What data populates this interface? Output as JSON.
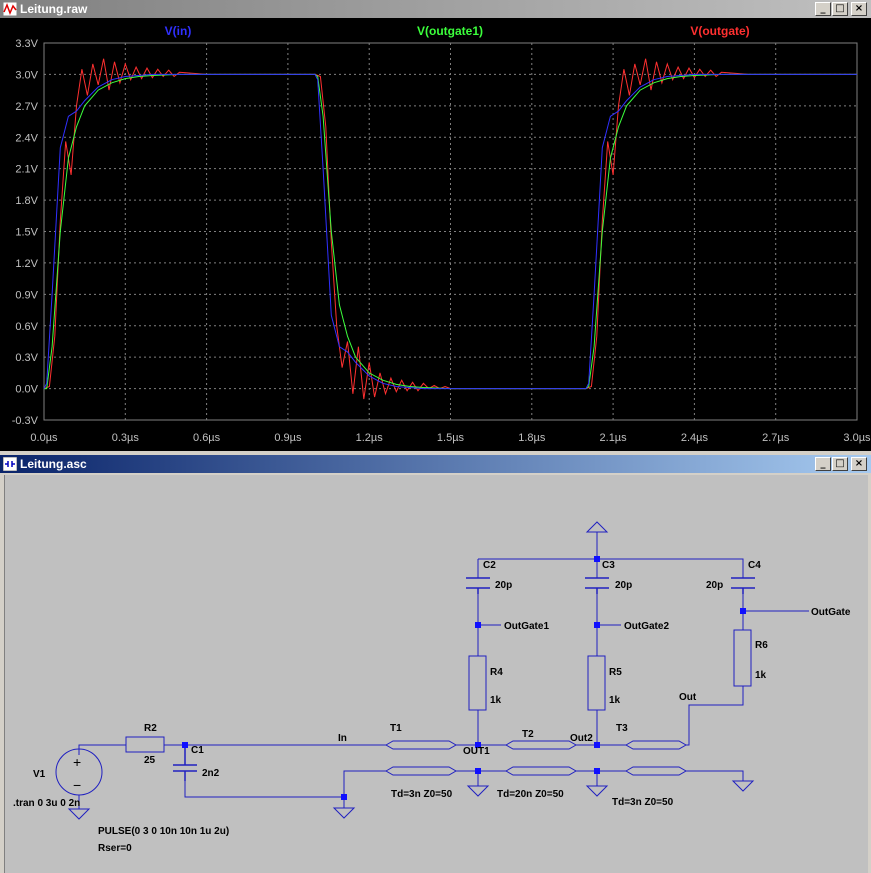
{
  "waveform_window": {
    "title": "Leitung.raw",
    "icon": "waveform-icon",
    "buttons": [
      "minimize-icon",
      "maximize-icon",
      "close-icon"
    ]
  },
  "schematic_window": {
    "title": "Leitung.asc",
    "icon": "schematic-icon",
    "buttons": [
      "minimize-icon",
      "maximize-icon",
      "close-icon"
    ]
  },
  "window_controls": {
    "minimize": "_",
    "maximize": "□",
    "close": "×"
  },
  "colors": {
    "plot_bg": "#000000",
    "grid": "#808080",
    "axis_text": "#c0c0c0",
    "vin": "#3030ff",
    "outgate1": "#3cff3c",
    "outgate": "#ff3030",
    "wire": "#2020c0",
    "junction": "#1010ff",
    "schematic_bg": "#c0c0c0"
  },
  "chart_data": {
    "type": "line",
    "title": "",
    "xlabel": "",
    "ylabel": "",
    "x_unit": "µs",
    "y_unit": "V",
    "xlim": [
      0.0,
      3.0
    ],
    "ylim": [
      -0.3,
      3.3
    ],
    "x_ticks": [
      "0.0µs",
      "0.3µs",
      "0.6µs",
      "0.9µs",
      "1.2µs",
      "1.5µs",
      "1.8µs",
      "2.1µs",
      "2.4µs",
      "2.7µs",
      "3.0µs"
    ],
    "y_ticks": [
      "3.3V",
      "3.0V",
      "2.7V",
      "2.4V",
      "2.1V",
      "1.8V",
      "1.5V",
      "1.2V",
      "0.9V",
      "0.6V",
      "0.3V",
      "0.0V",
      "-0.3V"
    ],
    "grid": true,
    "legend": "top",
    "series": [
      {
        "name": "V(in)",
        "color": "#3030ff",
        "x": [
          0.0,
          0.01,
          0.03,
          0.06,
          0.09,
          0.12,
          0.15,
          0.2,
          0.25,
          0.3,
          0.4,
          0.6,
          0.9,
          1.0,
          1.01,
          1.03,
          1.06,
          1.09,
          1.12,
          1.15,
          1.2,
          1.25,
          1.3,
          1.4,
          1.6,
          1.9,
          2.0,
          2.01,
          2.03,
          2.06,
          2.09,
          2.12,
          2.15,
          2.2,
          2.25,
          2.3,
          2.4,
          2.6,
          3.0
        ],
        "values": [
          0.0,
          0.05,
          0.9,
          2.3,
          2.6,
          2.65,
          2.75,
          2.88,
          2.95,
          2.98,
          3.0,
          3.0,
          3.0,
          3.0,
          2.95,
          2.1,
          0.7,
          0.4,
          0.35,
          0.25,
          0.12,
          0.05,
          0.02,
          0.0,
          0.0,
          0.0,
          0.0,
          0.05,
          0.9,
          2.3,
          2.6,
          2.65,
          2.75,
          2.88,
          2.95,
          2.98,
          3.0,
          3.0,
          3.0
        ]
      },
      {
        "name": "V(outgate1)",
        "color": "#3cff3c",
        "x": [
          0.0,
          0.01,
          0.03,
          0.06,
          0.09,
          0.12,
          0.15,
          0.2,
          0.25,
          0.3,
          0.35,
          0.4,
          0.5,
          0.7,
          1.0,
          1.01,
          1.03,
          1.06,
          1.09,
          1.12,
          1.15,
          1.2,
          1.25,
          1.3,
          1.35,
          1.4,
          1.5,
          1.7,
          2.0,
          2.01,
          2.03,
          2.06,
          2.09,
          2.12,
          2.15,
          2.2,
          2.25,
          2.3,
          2.35,
          2.4,
          2.5,
          2.7,
          3.0
        ],
        "values": [
          0.0,
          0.0,
          0.4,
          1.5,
          2.2,
          2.5,
          2.7,
          2.85,
          2.92,
          2.96,
          2.98,
          2.99,
          3.0,
          3.0,
          3.0,
          2.98,
          2.6,
          1.5,
          0.8,
          0.5,
          0.3,
          0.15,
          0.08,
          0.04,
          0.02,
          0.01,
          0.0,
          0.0,
          0.0,
          0.02,
          0.4,
          1.5,
          2.2,
          2.5,
          2.7,
          2.85,
          2.92,
          2.96,
          2.98,
          2.99,
          3.0,
          3.0,
          3.0
        ]
      },
      {
        "name": "V(outgate)",
        "color": "#ff3030",
        "x": [
          0.0,
          0.02,
          0.04,
          0.06,
          0.08,
          0.1,
          0.12,
          0.14,
          0.16,
          0.18,
          0.2,
          0.22,
          0.24,
          0.26,
          0.28,
          0.3,
          0.32,
          0.34,
          0.36,
          0.38,
          0.4,
          0.42,
          0.44,
          0.46,
          0.48,
          0.5,
          0.6,
          1.0,
          1.02,
          1.04,
          1.06,
          1.08,
          1.1,
          1.12,
          1.14,
          1.16,
          1.18,
          1.2,
          1.22,
          1.24,
          1.26,
          1.28,
          1.3,
          1.32,
          1.34,
          1.36,
          1.38,
          1.4,
          1.42,
          1.44,
          1.46,
          1.48,
          1.5,
          1.6,
          2.0,
          2.02,
          2.04,
          2.06,
          2.08,
          2.1,
          2.12,
          2.14,
          2.16,
          2.18,
          2.2,
          2.22,
          2.24,
          2.26,
          2.28,
          2.3,
          2.32,
          2.34,
          2.36,
          2.38,
          2.4,
          2.42,
          2.44,
          2.46,
          2.48,
          2.5,
          2.6,
          3.0
        ],
        "values": [
          0.0,
          0.02,
          0.5,
          1.6,
          2.36,
          2.04,
          2.7,
          3.05,
          2.8,
          3.1,
          2.9,
          3.15,
          2.85,
          3.12,
          2.92,
          3.1,
          2.95,
          3.07,
          2.96,
          3.06,
          2.97,
          3.05,
          2.98,
          3.04,
          2.98,
          3.02,
          3.0,
          3.0,
          2.98,
          2.5,
          1.4,
          0.6,
          0.2,
          0.45,
          -0.05,
          0.4,
          -0.1,
          0.25,
          -0.08,
          0.15,
          -0.05,
          0.1,
          -0.03,
          0.08,
          -0.02,
          0.06,
          -0.02,
          0.05,
          0.0,
          0.03,
          0.0,
          0.02,
          0.0,
          0.0,
          0.0,
          0.02,
          0.5,
          1.6,
          2.36,
          2.04,
          2.7,
          3.05,
          2.8,
          3.1,
          2.9,
          3.15,
          2.85,
          3.12,
          2.92,
          3.1,
          2.95,
          3.07,
          2.96,
          3.06,
          2.97,
          3.05,
          2.98,
          3.04,
          2.98,
          3.02,
          3.0,
          3.0
        ]
      }
    ]
  },
  "schematic": {
    "source": {
      "ref": "V1",
      "spice": ".tran 0 3u 0 2n",
      "pulse": "PULSE(0 3 0 10n 10n 1u 2u)",
      "rser": "Rser=0"
    },
    "resistors": [
      {
        "ref": "R2",
        "value": "25"
      },
      {
        "ref": "R4",
        "value": "1k"
      },
      {
        "ref": "R5",
        "value": "1k"
      },
      {
        "ref": "R6",
        "value": "1k"
      }
    ],
    "capacitors": [
      {
        "ref": "C1",
        "value": "2n2"
      },
      {
        "ref": "C2",
        "value": "20p"
      },
      {
        "ref": "C3",
        "value": "20p"
      },
      {
        "ref": "C4",
        "value": "20p"
      }
    ],
    "tlines": [
      {
        "ref": "T1",
        "params": "Td=3n Z0=50"
      },
      {
        "ref": "T2",
        "params": "Td=20n Z0=50"
      },
      {
        "ref": "T3",
        "params": "Td=3n Z0=50"
      }
    ],
    "nets": {
      "in": "In",
      "out1": "OUT1",
      "out2": "Out2",
      "out": "Out",
      "outgate1": "OutGate1",
      "outgate2": "OutGate2",
      "outgate": "OutGate"
    },
    "source_symbols": {
      "plus": "+",
      "minus": "−"
    }
  }
}
